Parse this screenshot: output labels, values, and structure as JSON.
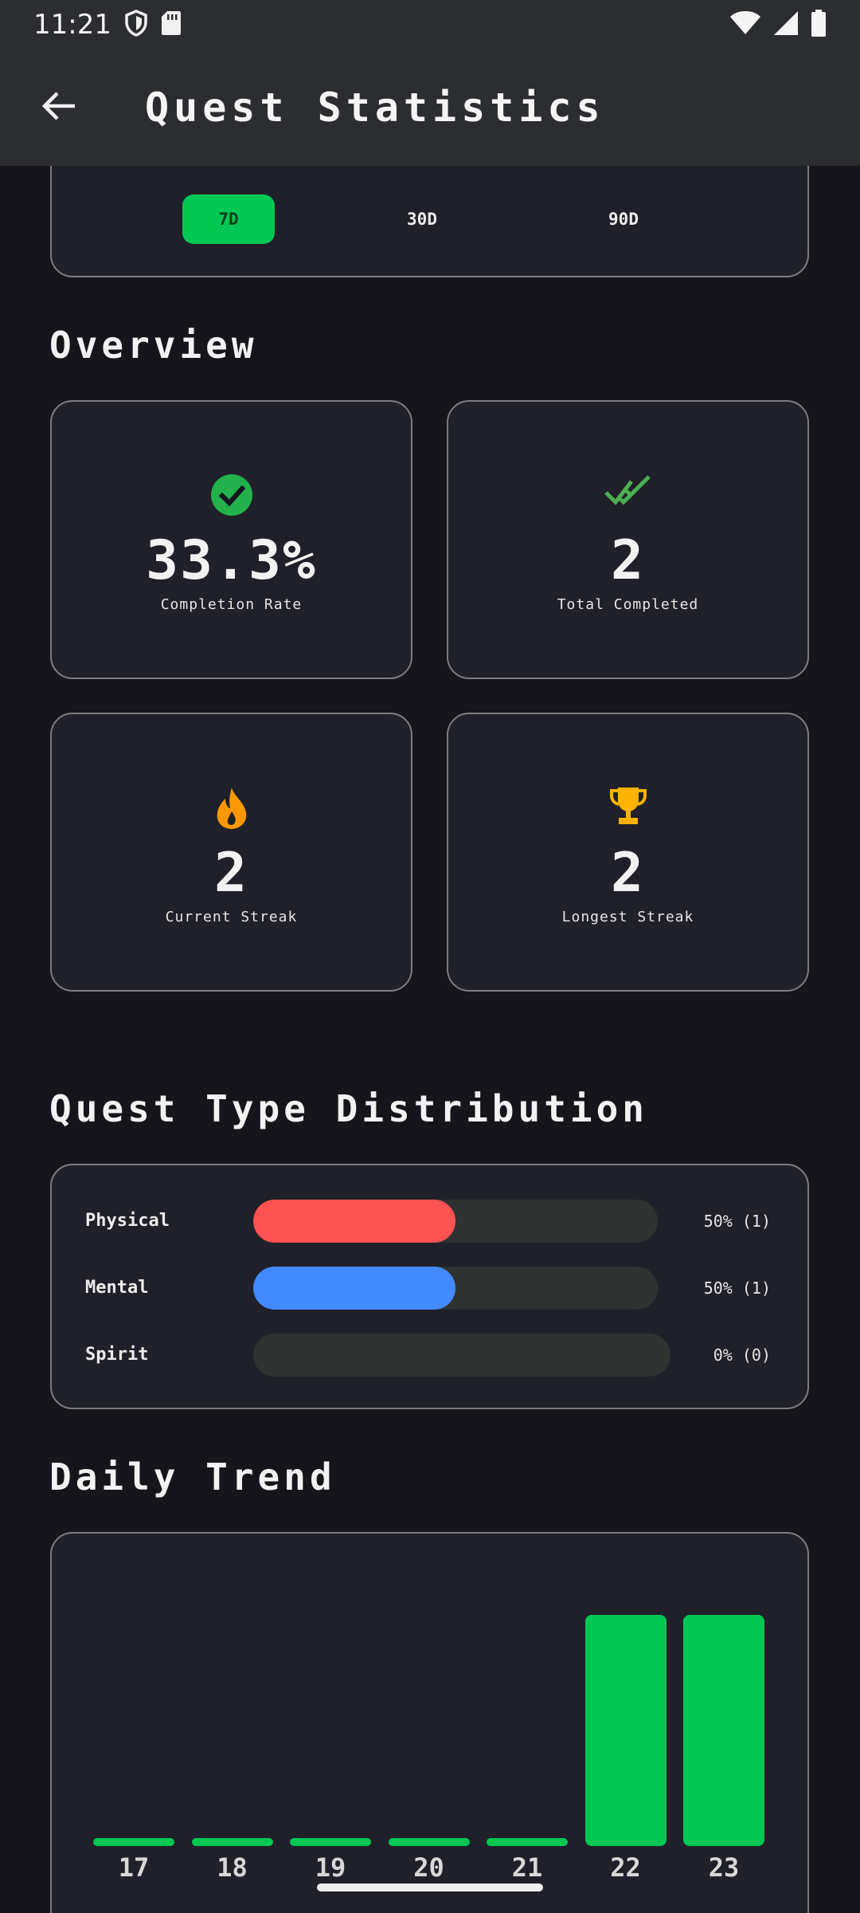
{
  "status_bar": {
    "time": "11:21"
  },
  "app_bar": {
    "title": "Quest Statistics"
  },
  "period": {
    "options": [
      "7D",
      "30D",
      "90D"
    ],
    "selected": "7D"
  },
  "overview": {
    "title": "Overview",
    "cards": [
      {
        "value": "33.3%",
        "label": "Completion Rate",
        "icon": "check-circle-icon",
        "color": "#22b14c"
      },
      {
        "value": "2",
        "label": "Total Completed",
        "icon": "double-check-icon",
        "color": "#4caf50"
      },
      {
        "value": "2",
        "label": "Current Streak",
        "icon": "flame-icon",
        "color": "#ff9800"
      },
      {
        "value": "2",
        "label": "Longest Streak",
        "icon": "trophy-icon",
        "color": "#ffb300"
      }
    ]
  },
  "distribution": {
    "title": "Quest Type Distribution",
    "rows": [
      {
        "label": "Physical",
        "value_text": "50% (1)",
        "percent": 50,
        "color": "#ff5252"
      },
      {
        "label": "Mental",
        "value_text": "50% (1)",
        "percent": 50,
        "color": "#448aff"
      },
      {
        "label": "Spirit",
        "value_text": "0% (0)",
        "percent": 0,
        "color": "#2e3230"
      }
    ]
  },
  "daily_trend": {
    "title": "Daily Trend",
    "chart_data": {
      "type": "bar",
      "categories": [
        "17",
        "18",
        "19",
        "20",
        "21",
        "22",
        "23"
      ],
      "values": [
        0,
        0,
        0,
        0,
        0,
        1,
        1
      ],
      "color": "#00c853"
    }
  }
}
